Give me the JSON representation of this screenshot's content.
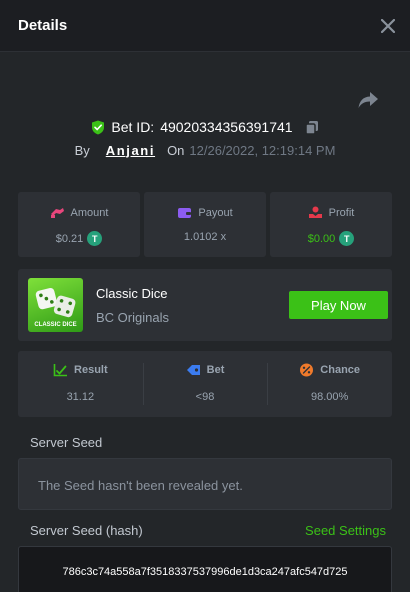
{
  "header": {
    "title": "Details"
  },
  "bet": {
    "id_label": "Bet ID:",
    "id": "49020334356391741",
    "by_label": "By",
    "user": "Anjani",
    "on_label": "On",
    "date": "12/26/2022, 12:19:14 PM"
  },
  "stats": [
    {
      "label": "Amount",
      "value": "$0.21",
      "icon": "amount-icon",
      "token": "T"
    },
    {
      "label": "Payout",
      "value": "1.0102 x",
      "icon": "wallet-icon"
    },
    {
      "label": "Profit",
      "value": "$0.00",
      "icon": "profit-icon",
      "token": "T"
    }
  ],
  "game": {
    "name": "Classic Dice",
    "provider": "BC Originals",
    "thumb_text": "CLASSIC DICE",
    "play_label": "Play Now"
  },
  "details": [
    {
      "label": "Result",
      "value": "31.12",
      "icon": "result-icon"
    },
    {
      "label": "Bet",
      "value": "<98",
      "icon": "bet-tag-icon"
    },
    {
      "label": "Chance",
      "value": "98.00%",
      "icon": "chance-icon"
    }
  ],
  "seed": {
    "server_label": "Server Seed",
    "server_text": "The Seed hasn't been revealed yet.",
    "hash_label": "Server Seed (hash)",
    "settings_label": "Seed Settings",
    "hash": "786c3c74a558a7f3518337537996de1d3ca247afc547d725"
  },
  "colors": {
    "accent_green": "#3bc117",
    "panel": "#232629",
    "card": "#2d3035",
    "amount_icon": "#e8467c",
    "wallet_icon": "#8c5cf0",
    "profit_icon": "#e6394b",
    "bet_icon": "#3b7cf0",
    "chance_icon": "#f07a2b",
    "tether": "#26a17b"
  }
}
